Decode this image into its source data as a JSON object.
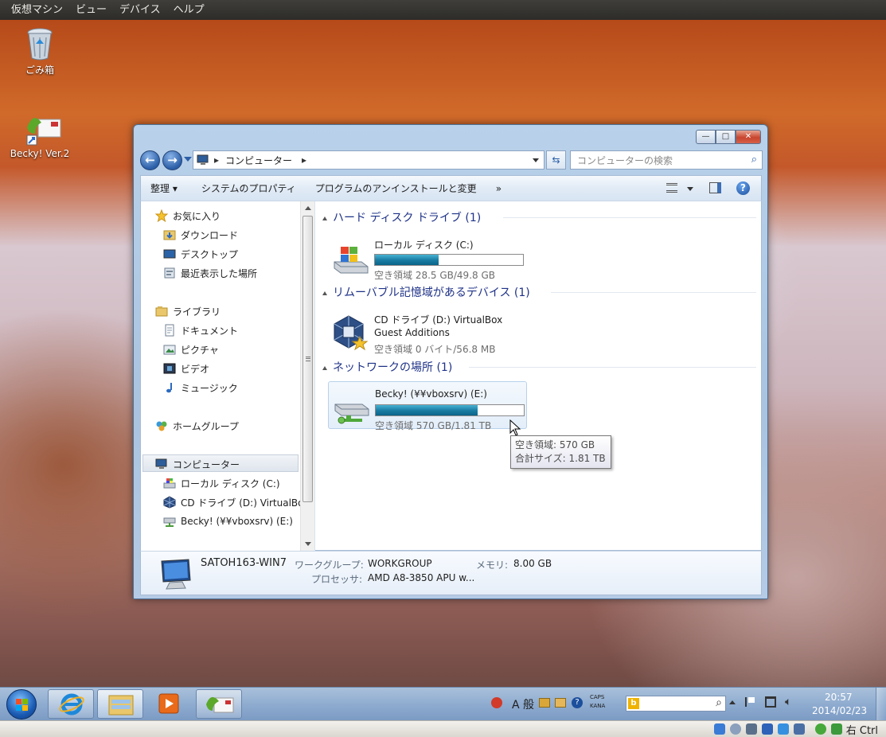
{
  "host_menu": [
    "仮想マシン",
    "ビュー",
    "デバイス",
    "ヘルプ"
  ],
  "desktop_icons": [
    {
      "label": "ごみ箱"
    },
    {
      "label": "Becky! Ver.2"
    }
  ],
  "window": {
    "buttons": {
      "minimize": "—",
      "maximize": "□",
      "close": "✕"
    },
    "address": {
      "crumb": "コンピューター",
      "sep": "▸"
    },
    "search_placeholder": "コンピューターの検索",
    "commands": [
      "整理 ▾",
      "システムのプロパティ",
      "プログラムのアンインストールと変更",
      "»"
    ],
    "nav": {
      "favorites": "お気に入り",
      "fav_items": [
        "ダウンロード",
        "デスクトップ",
        "最近表示した場所"
      ],
      "libraries": "ライブラリ",
      "lib_items": [
        "ドキュメント",
        "ピクチャ",
        "ビデオ",
        "ミュージック"
      ],
      "homegroup": "ホームグループ",
      "computer": "コンピューター",
      "computer_items": [
        "ローカル ディスク (C:)",
        "CD ドライブ (D:) VirtualBox",
        "Becky! (¥¥vboxsrv) (E:)"
      ]
    },
    "groups": [
      {
        "title": "ハード ディスク ドライブ (1)"
      },
      {
        "title": "リムーバブル記憶域があるデバイス (1)"
      },
      {
        "title": "ネットワークの場所 (1)"
      }
    ],
    "drives": {
      "c": {
        "name": "ローカル ディスク (C:)",
        "free": "空き領域 28.5 GB/49.8 GB",
        "used_fraction": 0.43
      },
      "d": {
        "name": "CD ドライブ (D:) VirtualBox",
        "name2": "Guest Additions",
        "free": "空き領域 0 バイト/56.8 MB"
      },
      "e": {
        "name": "Becky! (¥¥vboxsrv) (E:)",
        "free": "空き領域 570 GB/1.81 TB",
        "used_fraction": 0.69
      }
    },
    "tooltip": {
      "line1": "空き領域: 570 GB",
      "line2": "合計サイズ: 1.81 TB"
    },
    "status": {
      "computer_name": "SATOH163-WIN7",
      "workgroup_label": "ワークグループ:",
      "workgroup": "WORKGROUP",
      "memory_label": "メモリ:",
      "memory": "8.00 GB",
      "processor_label": "プロセッサ:",
      "processor": "AMD A8-3850 APU w..."
    }
  },
  "taskbar": {
    "ime": "A 般",
    "caps": "CAPS",
    "kana": "KANA",
    "time": "20:57",
    "date": "2014/02/23"
  },
  "vbox_status": {
    "host_key": "右 Ctrl"
  }
}
